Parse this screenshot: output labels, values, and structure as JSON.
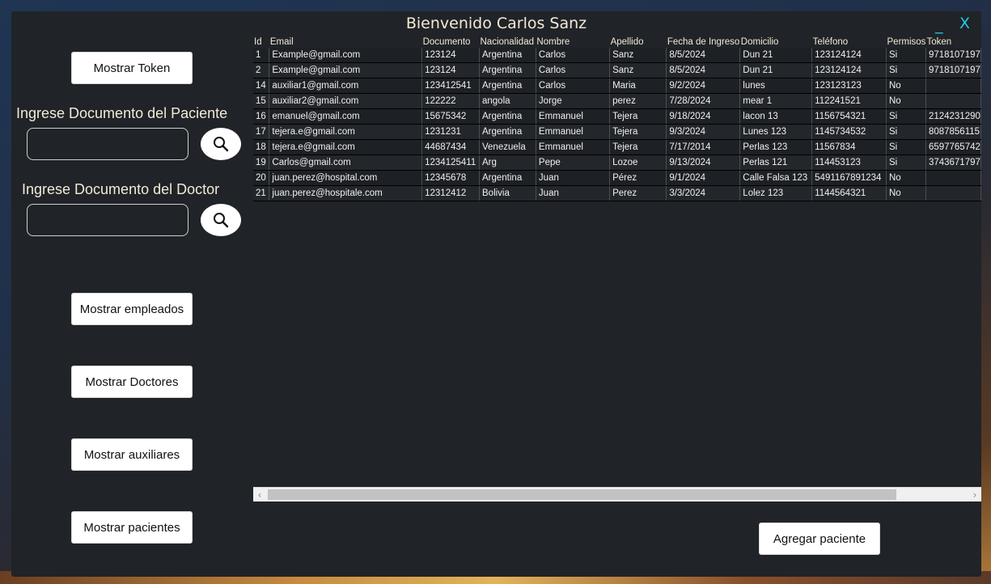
{
  "window": {
    "title": "Bienvenido Carlos Sanz",
    "minimize": "_",
    "close": "X"
  },
  "sidebar": {
    "token_button": "Mostrar Token",
    "patient_label": "Ingrese Documento del Paciente",
    "patient_input": "",
    "doctor_label": "Ingrese Documento del Doctor",
    "doctor_input": "",
    "employees_button": "Mostrar empleados",
    "doctors_button": "Mostrar Doctores",
    "assistants_button": "Mostrar auxiliares",
    "patients_button": "Mostrar pacientes"
  },
  "table": {
    "headers": [
      "Id",
      "Email",
      "Documento",
      "Nacionalidad",
      "Nombre",
      "Apellido",
      "Fecha de Ingreso",
      "Domicilio",
      "Teléfono",
      "Permisos",
      "Token"
    ],
    "rows": [
      [
        "1",
        "Example@gmail.com",
        "123124",
        "Argentina",
        "Carlos",
        "Sanz",
        "8/5/2024",
        "Dun 21",
        "123124124",
        "Si",
        "9718107197"
      ],
      [
        "2",
        "Example@gmail.com",
        "123124",
        "Argentina",
        "Carlos",
        "Sanz",
        "8/5/2024",
        "Dun 21",
        "123124124",
        "Si",
        "9718107197"
      ],
      [
        "14",
        "auxiliar1@gmail.com",
        "123412541",
        "Argentina",
        "Carlos",
        "Maria",
        "9/2/2024",
        "lunes",
        "123123123",
        "No",
        ""
      ],
      [
        "15",
        "auxiliar2@gmail.com",
        "122222",
        "angola",
        "Jorge",
        "perez",
        "7/28/2024",
        "mear 1",
        "112241521",
        "No",
        ""
      ],
      [
        "16",
        "emanuel@gmail.com",
        "15675342",
        "Argentina",
        "Emmanuel",
        "Tejera",
        "9/18/2024",
        "lacon 13",
        "1156754321",
        "Si",
        "2124231290"
      ],
      [
        "17",
        "tejera.e@gmail.com",
        "1231231",
        "Argentina",
        "Emmanuel",
        "Tejera",
        "9/3/2024",
        "Lunes 123",
        "1145734532",
        "Si",
        "8087856115"
      ],
      [
        "18",
        "tejera.e@gmail.com",
        "44687434",
        "Venezuela",
        "Emmanuel",
        "Tejera",
        "7/17/2014",
        "Perlas 123",
        "11567834",
        "Si",
        "6597765742"
      ],
      [
        "19",
        "Carlos@gmail.com",
        "1234125411",
        "Arg",
        "Pepe",
        "Lozoe",
        "9/13/2024",
        "Perlas 121",
        "114453123",
        "Si",
        "3743671797"
      ],
      [
        "20",
        "juan.perez@hospital.com",
        "12345678",
        "Argentina",
        "Juan",
        "Pérez",
        "9/1/2024",
        "Calle Falsa 123",
        "5491167891234",
        "No",
        ""
      ],
      [
        "21",
        "juan.perez@hospitale.com",
        "12312412",
        "Bolivia",
        "Juan",
        "Perez",
        "3/3/2024",
        "Lolez 123",
        "1144564321",
        "No",
        ""
      ]
    ]
  },
  "scrollbar": {
    "left_arrow": "‹",
    "right_arrow": "›"
  },
  "add_patient_button": "Agregar paciente",
  "icons": {
    "search": "search-icon"
  }
}
